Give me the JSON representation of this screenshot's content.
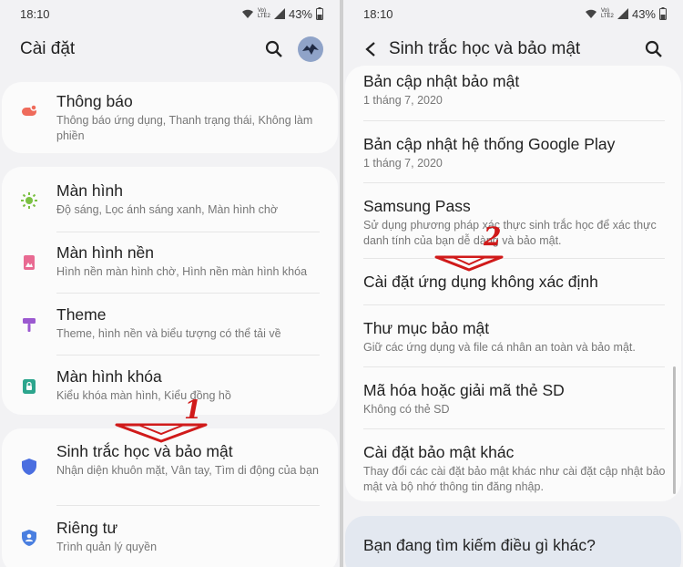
{
  "left": {
    "status": {
      "time": "18:10",
      "battery": "43%",
      "net": "VoLTE2",
      "net_top": "Vo)",
      "net_bot": "LTE2"
    },
    "header": {
      "title": "Cài đặt"
    },
    "items": [
      {
        "title": "Thông báo",
        "subtitle": "Thông báo ứng dụng, Thanh trạng thái, Không làm phiền",
        "icon": "notification-icon",
        "color": "#ef6b5b"
      },
      {
        "title": "Màn hình",
        "subtitle": "Độ sáng, Lọc ánh sáng xanh, Màn hình chờ",
        "icon": "brightness-icon",
        "color": "#7bc043"
      },
      {
        "title": "Màn hình nền",
        "subtitle": "Hình nền màn hình chờ, Hình nền màn hình khóa",
        "icon": "wallpaper-icon",
        "color": "#e86a92"
      },
      {
        "title": "Theme",
        "subtitle": "Theme, hình nền và biểu tượng có thể tải về",
        "icon": "theme-icon",
        "color": "#9b59d0"
      },
      {
        "title": "Màn hình khóa",
        "subtitle": "Kiểu khóa màn hình, Kiểu đồng hồ",
        "icon": "lock-screen-icon",
        "color": "#2ca58d"
      },
      {
        "title": "Sinh trắc học và bảo mật",
        "subtitle": "Nhận diện khuôn mặt, Vân tay, Tìm di động của bạn",
        "icon": "shield-icon",
        "color": "#4a6ee0"
      },
      {
        "title": "Riêng tư",
        "subtitle": "Trình quản lý quyền",
        "icon": "privacy-icon",
        "color": "#4a7fe0"
      }
    ],
    "annotation": "1"
  },
  "right": {
    "status": {
      "time": "18:10",
      "battery": "43%",
      "net_top": "Vo)",
      "net_bot": "LTE2"
    },
    "header": {
      "title": "Sinh trắc học và bảo mật"
    },
    "items": [
      {
        "title": "Bản cập nhật bảo mật",
        "subtitle": "1 tháng 7, 2020"
      },
      {
        "title": "Bản cập nhật hệ thống Google Play",
        "subtitle": "1 tháng 7, 2020"
      },
      {
        "title": "Samsung Pass",
        "subtitle": "Sử dụng phương pháp xác thực sinh trắc học để xác thực danh tính của bạn dễ dàng và bảo mật."
      },
      {
        "title": "Cài đặt ứng dụng không xác định",
        "subtitle": ""
      },
      {
        "title": "Thư mục bảo mật",
        "subtitle": "Giữ các ứng dụng và file cá nhân an toàn và bảo mật."
      },
      {
        "title": "Mã hóa hoặc giải mã thẻ SD",
        "subtitle": "Không có thẻ SD"
      },
      {
        "title": "Cài đặt bảo mật khác",
        "subtitle": "Thay đổi các cài đặt bảo mật khác như cài đặt cập nhật bảo mật và bộ nhớ thông tin đăng nhập."
      }
    ],
    "search_prompt": "Bạn đang tìm kiếm điều gì khác?",
    "annotation": "2"
  }
}
